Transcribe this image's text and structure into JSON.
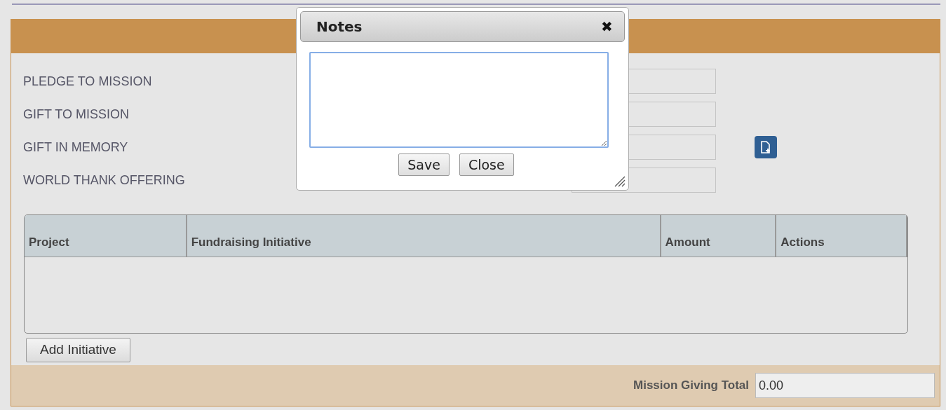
{
  "form": {
    "fields": [
      {
        "label": "PLEDGE TO MISSION",
        "has_action_icon": false
      },
      {
        "label": "GIFT TO MISSION",
        "has_action_icon": false
      },
      {
        "label": "GIFT IN MEMORY",
        "has_action_icon": true
      },
      {
        "label": "WORLD THANK OFFERING",
        "has_action_icon": false
      }
    ]
  },
  "table": {
    "columns": [
      "Project",
      "Fundraising Initiative",
      "Amount",
      "Actions"
    ]
  },
  "add_button": "Add Initiative",
  "footer": {
    "label": "Mission Giving Total",
    "value": "0.00"
  },
  "dialog": {
    "title": "Notes",
    "close_glyph": "✖",
    "notes": {
      "focused": true
    },
    "buttons": [
      "Save",
      "Close"
    ]
  }
}
